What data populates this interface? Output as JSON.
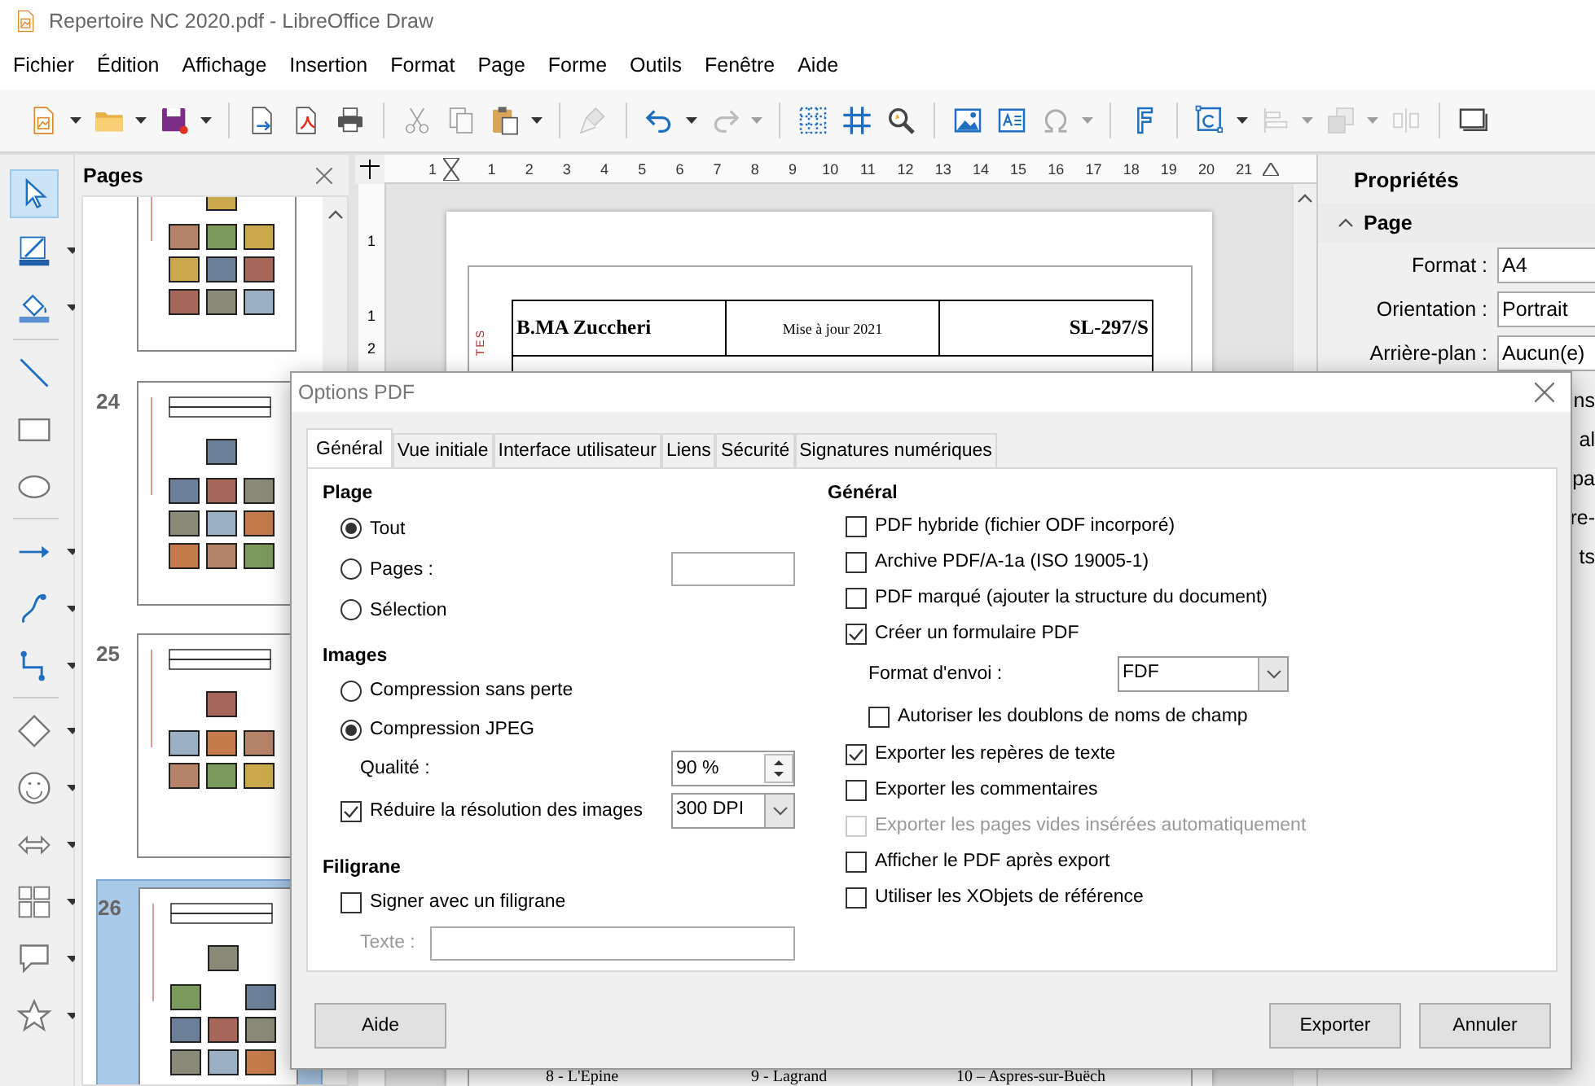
{
  "window": {
    "title": "Repertoire NC 2020.pdf - LibreOffice Draw"
  },
  "menu": [
    "Fichier",
    "Édition",
    "Affichage",
    "Insertion",
    "Format",
    "Page",
    "Forme",
    "Outils",
    "Fenêtre",
    "Aide"
  ],
  "toolbar": [
    {
      "kind": "new-drawing",
      "disabled": false,
      "menu": true
    },
    {
      "kind": "open",
      "disabled": false,
      "menu": true
    },
    {
      "kind": "save",
      "disabled": false,
      "menu": true
    },
    {
      "kind": "separator"
    },
    {
      "kind": "export",
      "disabled": false,
      "menu": false
    },
    {
      "kind": "export-pdf",
      "disabled": false,
      "menu": false
    },
    {
      "kind": "print",
      "disabled": false,
      "menu": false
    },
    {
      "kind": "separator"
    },
    {
      "kind": "cut",
      "disabled": true,
      "menu": false
    },
    {
      "kind": "copy",
      "disabled": true,
      "menu": false
    },
    {
      "kind": "paste",
      "disabled": false,
      "menu": true
    },
    {
      "kind": "separator"
    },
    {
      "kind": "clone",
      "disabled": true,
      "menu": false
    },
    {
      "kind": "separator"
    },
    {
      "kind": "undo",
      "disabled": false,
      "menu": true
    },
    {
      "kind": "redo",
      "disabled": true,
      "menu": true
    },
    {
      "kind": "separator"
    },
    {
      "kind": "grid",
      "disabled": false,
      "menu": false
    },
    {
      "kind": "helplines",
      "disabled": false,
      "menu": false
    },
    {
      "kind": "zoom",
      "disabled": false,
      "menu": false
    },
    {
      "kind": "separator"
    },
    {
      "kind": "image",
      "disabled": false,
      "menu": false
    },
    {
      "kind": "textbox",
      "disabled": false,
      "menu": false
    },
    {
      "kind": "special-char",
      "disabled": true,
      "menu": true
    },
    {
      "kind": "separator"
    },
    {
      "kind": "fontwork",
      "disabled": false,
      "menu": false
    },
    {
      "kind": "separator"
    },
    {
      "kind": "transform",
      "disabled": false,
      "menu": true
    },
    {
      "kind": "align",
      "disabled": true,
      "menu": true
    },
    {
      "kind": "arrange",
      "disabled": true,
      "menu": true
    },
    {
      "kind": "distribute",
      "disabled": true,
      "menu": false
    },
    {
      "kind": "separator"
    },
    {
      "kind": "shadow",
      "disabled": false,
      "menu": false
    }
  ],
  "tools": [
    {
      "kind": "select",
      "selected": true,
      "menu": false
    },
    {
      "kind": "line-color",
      "selected": false,
      "menu": true
    },
    {
      "kind": "fill-color",
      "selected": false,
      "menu": true
    },
    {
      "kind": "separator"
    },
    {
      "kind": "line",
      "selected": false,
      "menu": false
    },
    {
      "kind": "rectangle",
      "selected": false,
      "menu": false
    },
    {
      "kind": "ellipse",
      "selected": false,
      "menu": false
    },
    {
      "kind": "separator"
    },
    {
      "kind": "arrow-line",
      "selected": false,
      "menu": true
    },
    {
      "kind": "curve",
      "selected": false,
      "menu": true
    },
    {
      "kind": "connector",
      "selected": false,
      "menu": true
    },
    {
      "kind": "separator"
    },
    {
      "kind": "diamond",
      "selected": false,
      "menu": true
    },
    {
      "kind": "smiley",
      "selected": false,
      "menu": true
    },
    {
      "kind": "double-arrow",
      "selected": false,
      "menu": true
    },
    {
      "kind": "layout",
      "selected": false,
      "menu": true
    },
    {
      "kind": "callout",
      "selected": false,
      "menu": true
    },
    {
      "kind": "star",
      "selected": false,
      "menu": true
    }
  ],
  "pages_panel": {
    "title": "Pages",
    "pages": [
      {
        "selected": false
      },
      {
        "number": "24",
        "selected": false
      },
      {
        "number": "25",
        "selected": false
      },
      {
        "number": "26",
        "selected": true
      }
    ]
  },
  "document": {
    "ruler": {
      "horizontal": [
        "1",
        "1",
        "2",
        "3",
        "4",
        "5",
        "6",
        "7",
        "8",
        "9",
        "10",
        "11",
        "12",
        "13",
        "14",
        "15",
        "16",
        "17",
        "18",
        "19",
        "20",
        "21"
      ],
      "vertical": [
        "1",
        "1",
        "2"
      ]
    },
    "header_cells": [
      "B.MA Zuccheri",
      "Mise à jour 2021",
      "SL-297/S"
    ],
    "side_text": "TES",
    "captions": [
      "8 - L'Epine",
      "9 - Lagrand",
      "10 – Aspres-sur-Buëch"
    ]
  },
  "properties": {
    "title": "Propriétés",
    "section": {
      "title": "Page",
      "expanded": true
    },
    "fields": [
      {
        "label": "Format :",
        "value": "A4"
      },
      {
        "label": "Orientation :",
        "value": "Portrait"
      },
      {
        "label": "Arrière-plan :",
        "value": "Aucun(e)"
      }
    ],
    "fragments": [
      "ns",
      "al",
      "pa",
      "re-",
      "ts"
    ]
  },
  "dialog": {
    "title": "Options PDF",
    "tabs": [
      {
        "label": "Général",
        "selected": true
      },
      {
        "label": "Vue initiale",
        "selected": false
      },
      {
        "label": "Interface utilisateur",
        "selected": false
      },
      {
        "label": "Liens",
        "selected": false
      },
      {
        "label": "Sécurité",
        "selected": false
      },
      {
        "label": "Signatures numériques",
        "selected": false
      }
    ],
    "range": {
      "heading": "Plage",
      "options": [
        {
          "kind": "radio",
          "label": "Tout",
          "selected": true
        },
        {
          "kind": "radio-field",
          "label": "Pages :",
          "selected": false
        },
        {
          "kind": "radio",
          "label": "Sélection",
          "selected": false
        }
      ]
    },
    "images": {
      "heading": "Images",
      "options": [
        {
          "label": "Compression sans perte",
          "selected": false
        },
        {
          "label": "Compression JPEG",
          "selected": true
        }
      ],
      "quality": {
        "label": "Qualité :",
        "value": "90 %"
      },
      "reduce": {
        "label": "Réduire la résolution des images",
        "checked": true,
        "value": "300 DPI"
      }
    },
    "watermark": {
      "heading": "Filigrane",
      "sign": {
        "label": "Signer avec un filigrane",
        "checked": false
      },
      "text": {
        "label": "Texte :",
        "disabled": true
      }
    },
    "general": {
      "heading": "Général",
      "options": [
        {
          "kind": "checkbox",
          "label": "PDF hybride (fichier ODF incorporé)",
          "checked": false,
          "disabled": false
        },
        {
          "kind": "checkbox",
          "label": "Archive PDF/A-1a (ISO 19005-1)",
          "checked": false,
          "disabled": false
        },
        {
          "kind": "checkbox",
          "label": "PDF marqué (ajouter la structure du document)",
          "checked": false,
          "disabled": false
        },
        {
          "kind": "checkbox",
          "label": "Créer un formulaire PDF",
          "checked": true,
          "disabled": false
        },
        {
          "kind": "select",
          "label": "Format d'envoi :",
          "value": "FDF"
        },
        {
          "kind": "sub-checkbox",
          "label": "Autoriser les doublons de noms de champ",
          "checked": false,
          "disabled": false
        },
        {
          "kind": "checkbox",
          "label": "Exporter les repères de texte",
          "checked": true,
          "disabled": false
        },
        {
          "kind": "checkbox",
          "label": "Exporter les commentaires",
          "checked": false,
          "disabled": false
        },
        {
          "kind": "checkbox",
          "label": "Exporter les pages vides insérées automatiquement",
          "checked": false,
          "disabled": true
        },
        {
          "kind": "checkbox",
          "label": "Afficher le PDF après export",
          "checked": false,
          "disabled": false
        },
        {
          "kind": "checkbox",
          "label": "Utiliser les XObjets de référence",
          "checked": false,
          "disabled": false
        }
      ]
    },
    "help_button": "Aide",
    "buttons": [
      "Exporter",
      "Annuler"
    ]
  }
}
